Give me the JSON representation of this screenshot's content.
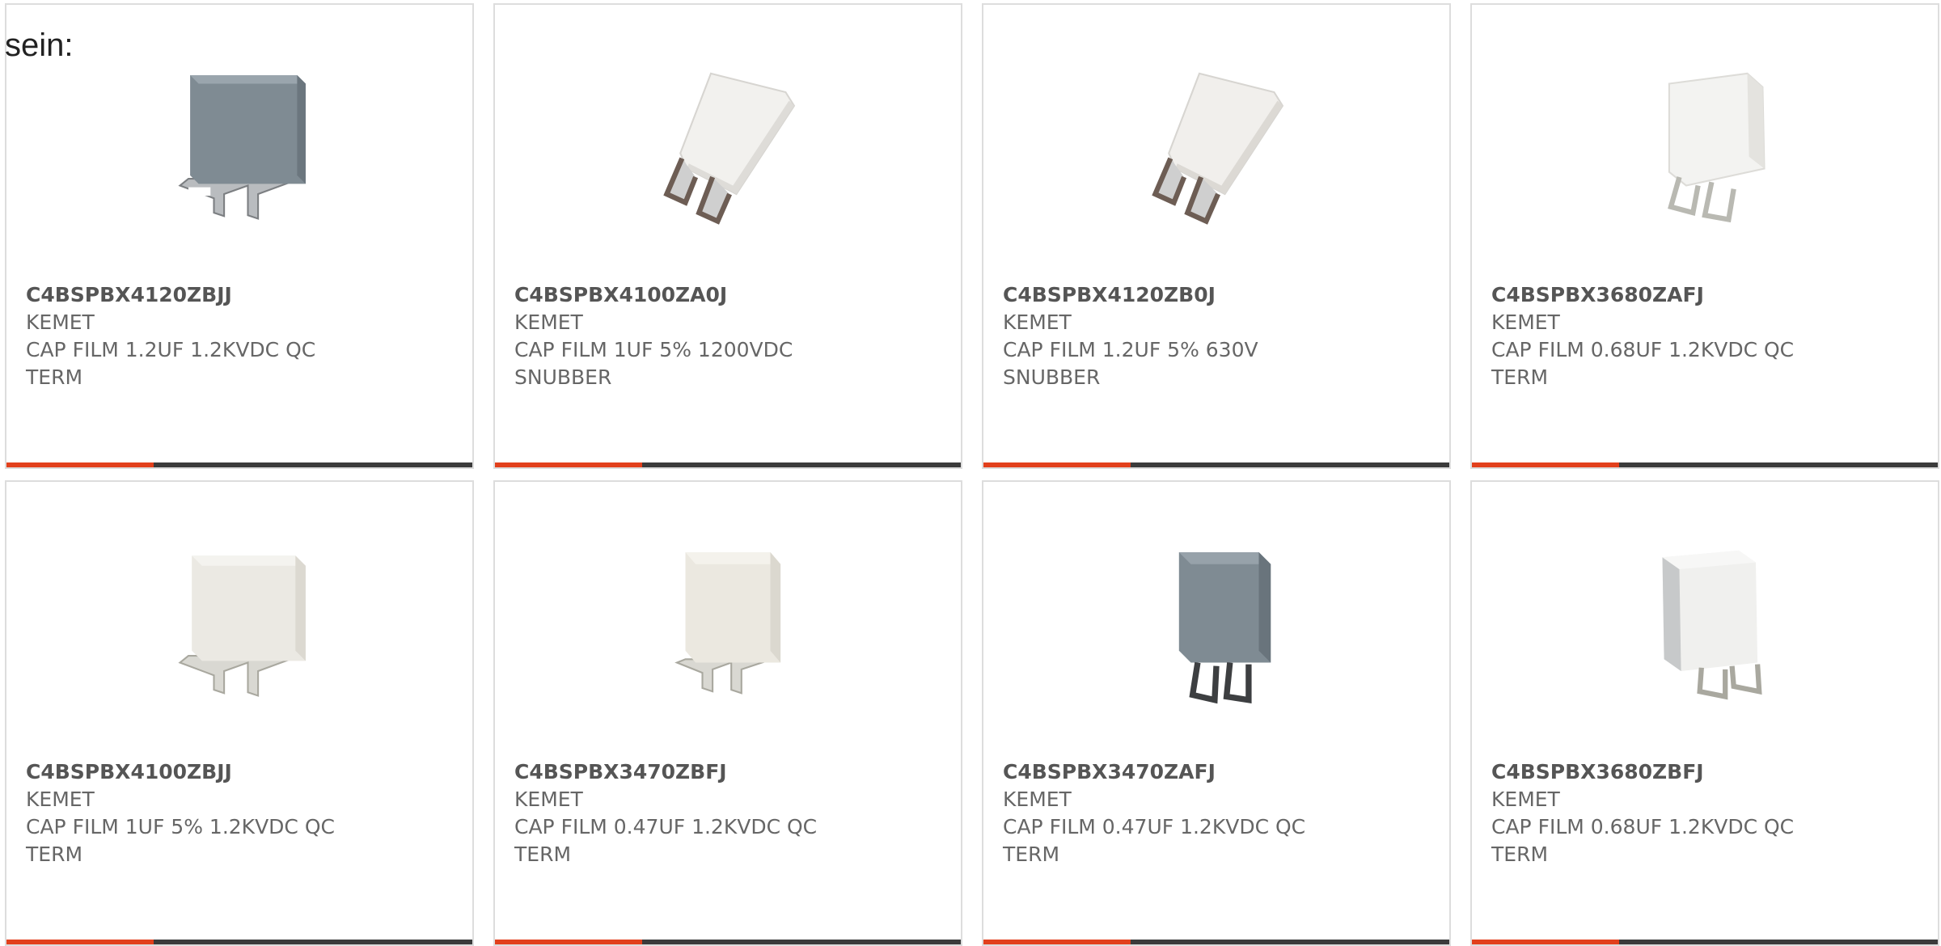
{
  "intro_text": "sein:",
  "colors": {
    "accent": "#e2401c",
    "bar_dark": "#3b3b3b",
    "border": "#dddddd"
  },
  "products": [
    {
      "part_number": "C4BSPBX4120ZBJJ",
      "manufacturer": "KEMET",
      "description": "CAP FILM 1.2UF 1.2KVDC QC TERM",
      "body_color": "gray"
    },
    {
      "part_number": "C4BSPBX4100ZA0J",
      "manufacturer": "KEMET",
      "description": "CAP FILM 1UF 5% 1200VDC SNUBBER",
      "body_color": "white"
    },
    {
      "part_number": "C4BSPBX4120ZB0J",
      "manufacturer": "KEMET",
      "description": "CAP FILM 1.2UF 5% 630V SNUBBER",
      "body_color": "white"
    },
    {
      "part_number": "C4BSPBX3680ZAFJ",
      "manufacturer": "KEMET",
      "description": "CAP FILM 0.68UF 1.2KVDC QC TERM",
      "body_color": "white"
    },
    {
      "part_number": "C4BSPBX4100ZBJJ",
      "manufacturer": "KEMET",
      "description": "CAP FILM 1UF 5% 1.2KVDC QC TERM",
      "body_color": "cream"
    },
    {
      "part_number": "C4BSPBX3470ZBFJ",
      "manufacturer": "KEMET",
      "description": "CAP FILM 0.47UF 1.2KVDC QC TERM",
      "body_color": "cream"
    },
    {
      "part_number": "C4BSPBX3470ZAFJ",
      "manufacturer": "KEMET",
      "description": "CAP FILM 0.47UF 1.2KVDC QC TERM",
      "body_color": "gray"
    },
    {
      "part_number": "C4BSPBX3680ZBFJ",
      "manufacturer": "KEMET",
      "description": "CAP FILM 0.68UF 1.2KVDC QC TERM",
      "body_color": "white"
    }
  ]
}
